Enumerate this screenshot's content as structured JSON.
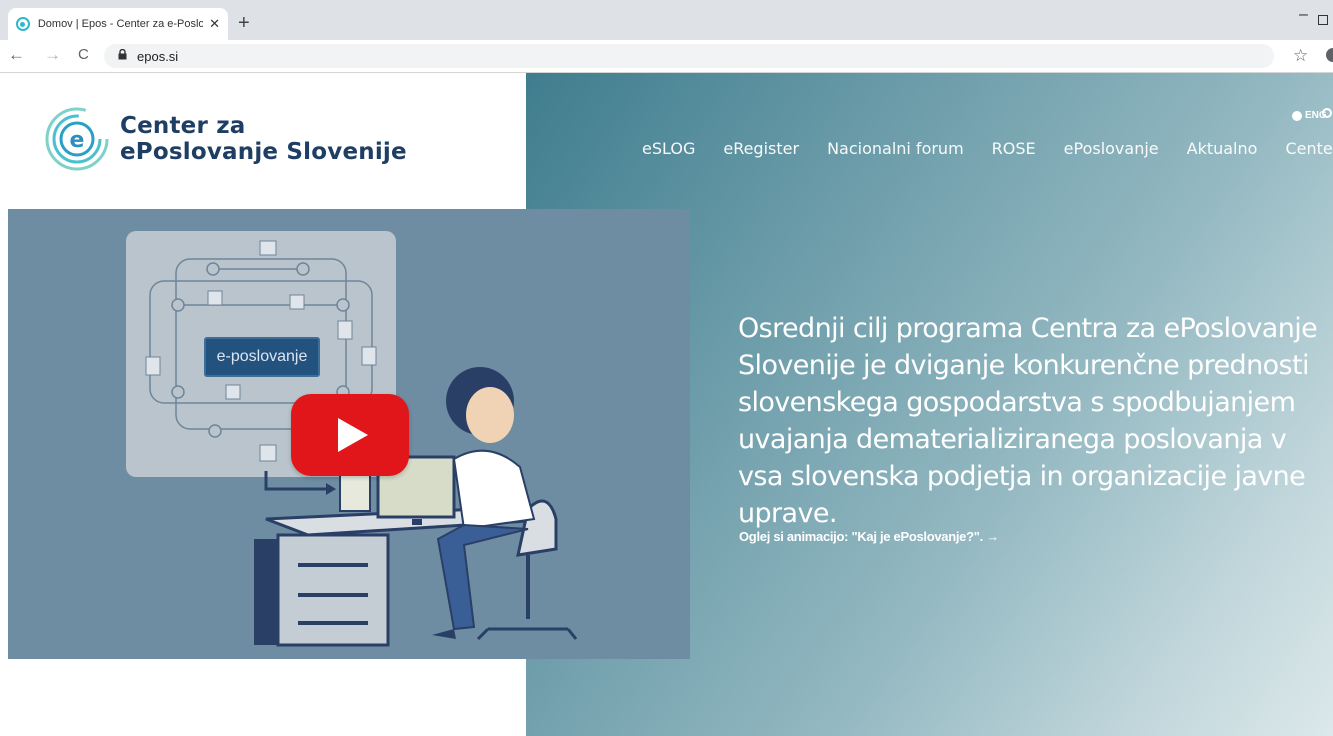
{
  "browser": {
    "tab_title": "Domov | Epos - Center za e-Poslovanje",
    "tab_close": "✕",
    "new_tab": "+",
    "url": "epos.si",
    "back": "←",
    "forward": "→",
    "reload": "C",
    "lock": "🔒",
    "star": "☆",
    "minimize": "–"
  },
  "header": {
    "logo_line1": "Center za",
    "logo_line2": "ePoslovanje Slovenije",
    "lang_label": "ENG",
    "nav": [
      "eSLOG",
      "eRegister",
      "Nacionalni forum",
      "ROSE",
      "ePoslovanje",
      "Aktualno",
      "Center"
    ]
  },
  "video": {
    "diagram_label": "e-poslovanje"
  },
  "hero": {
    "headline": "Osrednji cilj programa Centra za ePoslovanje Slovenije je dviganje konkurenčne prednosti slovenskega gospodarstva s spodbujanjem uvajanja dematerializiranega poslovanja v vsa slovenska podjetja in organizacije javne uprave.",
    "cta": "Oglej si animacijo: \"Kaj je ePoslovanje?\". →"
  },
  "colors": {
    "brand_navy": "#1f3e64",
    "brand_teal": "#30b8c9",
    "youtube_red": "#e0161a"
  }
}
